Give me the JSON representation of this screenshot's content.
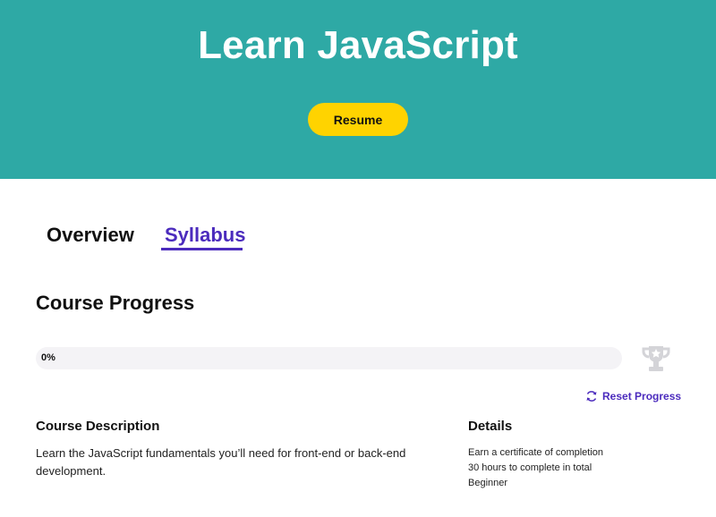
{
  "hero": {
    "title": "Learn JavaScript",
    "resume_label": "Resume",
    "bg_color": "#2ea9a5",
    "button_color": "#ffd300"
  },
  "tabs": [
    {
      "label": "Overview",
      "active": false
    },
    {
      "label": "Syllabus",
      "active": true
    }
  ],
  "accent_color": "#4b2bbd",
  "progress": {
    "title": "Course Progress",
    "percent": 0,
    "percent_label": "0%",
    "trophy_icon": "trophy-icon",
    "reset_label": "Reset Progress",
    "reset_icon": "refresh-icon"
  },
  "description": {
    "title": "Course Description",
    "text": "Learn the JavaScript fundamentals you’ll need for front-end or back-end development."
  },
  "details": {
    "title": "Details",
    "items": [
      "Earn a certificate of completion",
      "30 hours to complete in total",
      "Beginner"
    ]
  }
}
